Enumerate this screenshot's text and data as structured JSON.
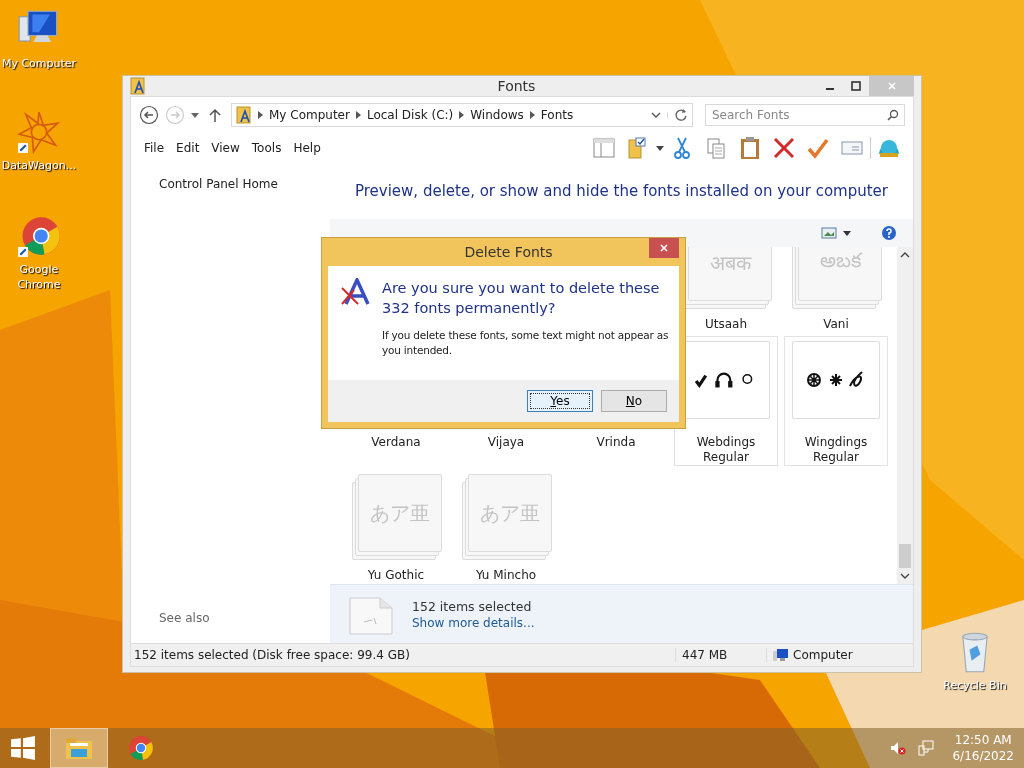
{
  "desktop_icons": [
    {
      "label": "My Computer",
      "kind": "computer"
    },
    {
      "label": "DataWagon...",
      "kind": "star"
    },
    {
      "label": "Google Chrome",
      "kind": "chrome"
    },
    {
      "label": "Recycle Bin",
      "kind": "bin"
    }
  ],
  "window": {
    "title": "Fonts",
    "breadcrumb": [
      "My Computer",
      "Local Disk (C:)",
      "Windows",
      "Fonts"
    ],
    "search": {
      "placeholder": "Search Fonts"
    },
    "menu": [
      "File",
      "Edit",
      "View",
      "Tools",
      "Help"
    ],
    "sidebar": {
      "link": "Control Panel Home",
      "see_also": "See also"
    },
    "heading": "Preview, delete, or show and hide the fonts installed on your computer",
    "tiles": [
      {
        "name": "Utsaah",
        "kind": "text",
        "preview": "अबक",
        "stacked": true
      },
      {
        "name": "Vani",
        "kind": "text",
        "preview": "అబక",
        "stacked": true
      },
      {
        "name": "Verdana",
        "kind": "text"
      },
      {
        "name": "Vijaya",
        "kind": "text"
      },
      {
        "name": "Vrinda",
        "kind": "text"
      },
      {
        "name": "Webdings Regular",
        "kind": "marks",
        "stacked": false
      },
      {
        "name": "Wingdings Regular",
        "kind": "ornaments",
        "stacked": false
      },
      {
        "name": "Yu Gothic",
        "kind": "text",
        "preview": "あア亜",
        "stacked": true
      },
      {
        "name": "Yu Mincho",
        "kind": "text",
        "preview": "あア亜",
        "stacked": true
      }
    ],
    "details": {
      "count": "152 items selected",
      "link": "Show more details..."
    },
    "status_bar": {
      "selection": "152 items selected (Disk free space: 99.4 GB)",
      "size": "447 MB",
      "zone": "Computer"
    }
  },
  "dialog": {
    "title": "Delete Fonts",
    "question": "Are you sure you want to delete these 332 fonts permanently?",
    "note": "If you delete these fonts, some text might not appear as you intended.",
    "buttons": [
      {
        "label": "Yes",
        "selected": true
      },
      {
        "label": "No",
        "selected": false
      }
    ]
  },
  "taskbar": {
    "apps": [
      {
        "kind": "explorer",
        "selected": true
      },
      {
        "kind": "chrome",
        "selected": false
      }
    ],
    "time": "12:50 AM",
    "date": "6/16/2022"
  }
}
